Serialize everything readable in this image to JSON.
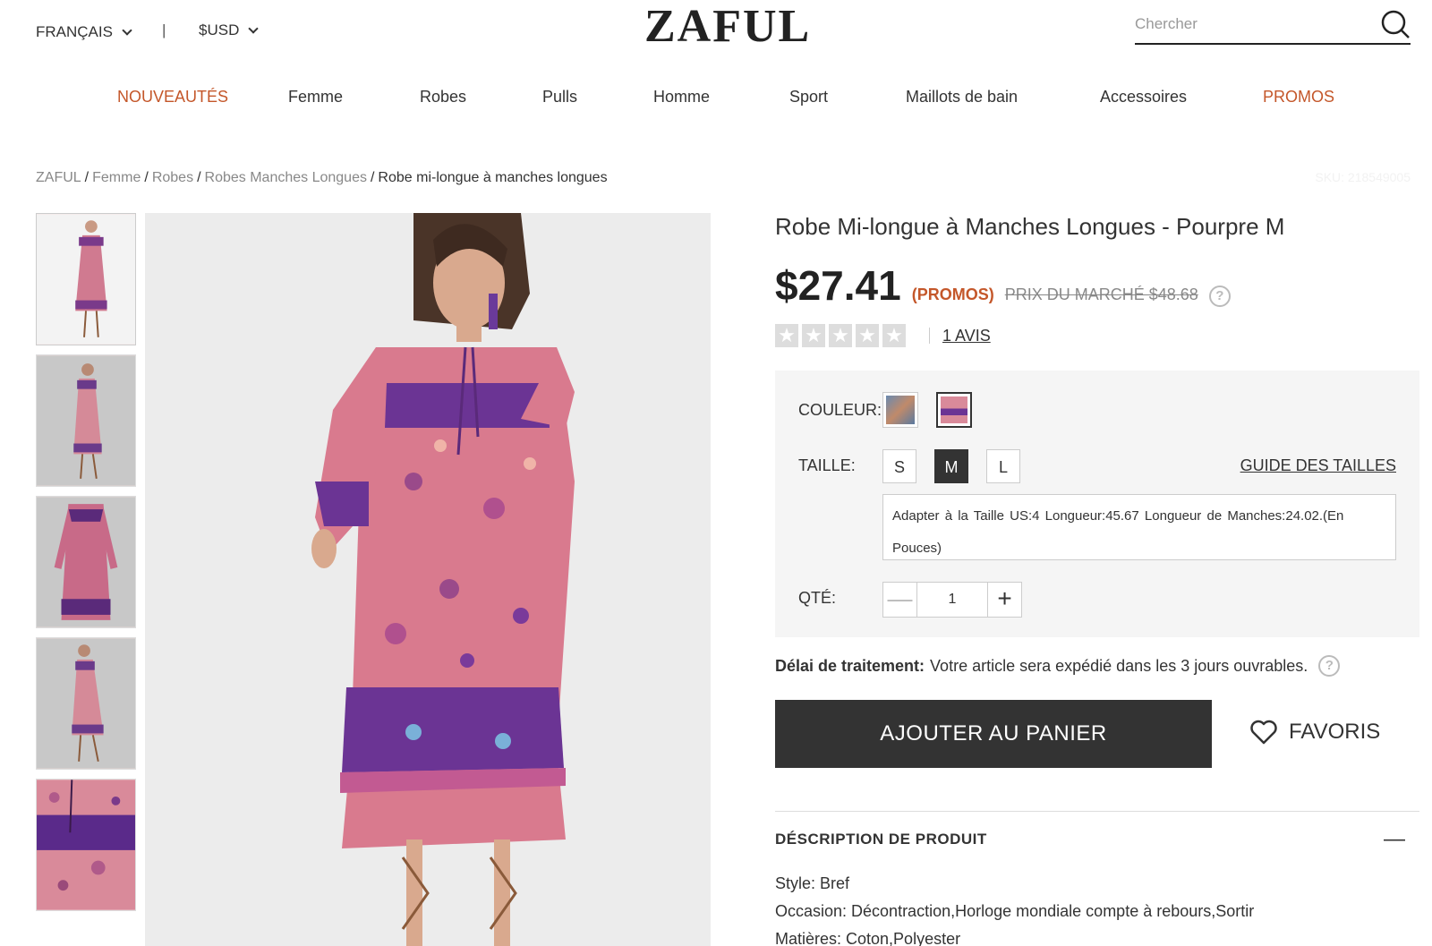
{
  "header": {
    "language": "FRANÇAIS",
    "currency": "$USD",
    "separator": "|",
    "logo": "ZAFUL",
    "search_placeholder": "Chercher"
  },
  "nav": [
    {
      "label": "NOUVEAUTÉS",
      "highlight": true
    },
    {
      "label": "Femme",
      "highlight": false
    },
    {
      "label": "Robes",
      "highlight": false
    },
    {
      "label": "Pulls",
      "highlight": false
    },
    {
      "label": "Homme",
      "highlight": false
    },
    {
      "label": "Sport",
      "highlight": false
    },
    {
      "label": "Maillots de bain",
      "highlight": false
    },
    {
      "label": "Accessoires",
      "highlight": false
    },
    {
      "label": "PROMOS",
      "highlight": true
    }
  ],
  "breadcrumb": [
    "ZAFUL",
    "Femme",
    "Robes",
    "Robes Manches Longues",
    "Robe mi-longue à manches longues"
  ],
  "sku": "SKU: 218549005",
  "product": {
    "title": "Robe Mi-longue à Manches Longues - Pourpre M",
    "price": "$27.41",
    "promo_label": "(PROMOS)",
    "market_price": "PRIX DU MARCHÉ $48.68",
    "help_icon": "?",
    "rating": 0,
    "reviews": "1 AVIS",
    "color_label": "COULEUR:",
    "size_label": "TAILLE:",
    "sizes": [
      "S",
      "M",
      "L"
    ],
    "selected_size": "M",
    "size_guide": "GUIDE DES TAILLES",
    "size_info": "Adapter à la Taille US:4   Longueur:45.67   Longueur de Manches:24.02.(En Pouces)",
    "qty_label": "QTÉ:",
    "qty_value": "1",
    "qty_minus": "—",
    "qty_plus": "+",
    "delay_label": "Délai de traitement:",
    "delay_text": "Votre article sera expédié dans les 3 jours ouvrables.",
    "add_to_cart": "AJOUTER AU PANIER",
    "favorites": "FAVORIS",
    "description_title": "DÉSCRIPTION DE PRODUIT",
    "description_toggle": "—",
    "description": [
      "Style: Bref",
      "Occasion: Décontraction,Horloge mondiale compte à rebours,Sortir",
      "Matières: Coton,Polyester"
    ]
  },
  "colors": {
    "accent": "#c4572a",
    "button": "#333333"
  }
}
